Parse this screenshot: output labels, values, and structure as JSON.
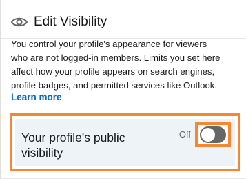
{
  "header": {
    "title": "Edit Visibility",
    "icon": "eye-icon"
  },
  "description": {
    "lines": [
      "You control your profile's appearance for viewers",
      "who are not logged-in members. Limits you set here",
      "affect how your profile appears on search engines,",
      "profile badges, and permitted services like Outlook."
    ]
  },
  "learn_more": {
    "label": "Learn more"
  },
  "public_visibility": {
    "label_lines": [
      "Your profile's public",
      "visibility"
    ],
    "state_label": "Off",
    "enabled": false
  },
  "colors": {
    "highlight": "#f58633",
    "link": "#0a66c2",
    "row_background": "#eef3f8",
    "toggle_off": "#666666"
  }
}
